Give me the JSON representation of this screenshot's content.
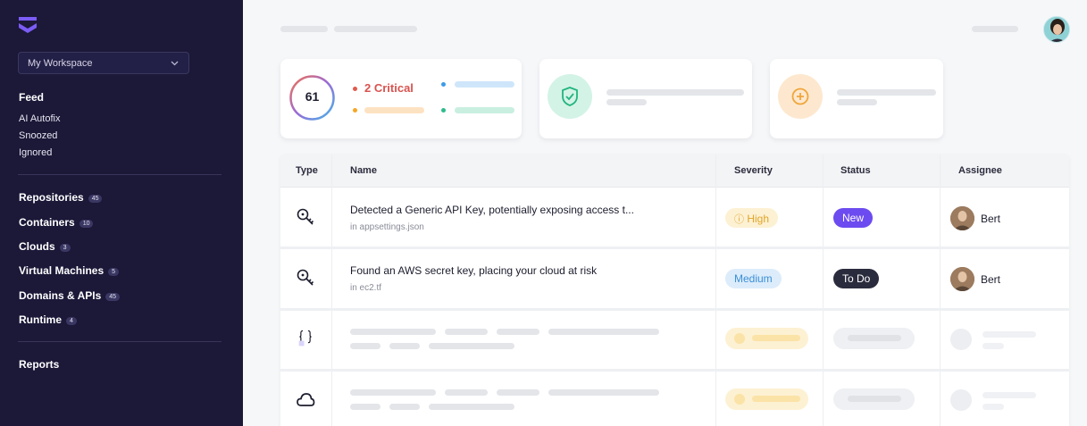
{
  "sidebar": {
    "workspace": "My Workspace",
    "feed_label": "Feed",
    "feed_items": [
      "AI Autofix",
      "Snoozed",
      "Ignored"
    ],
    "nav": [
      {
        "label": "Repositories",
        "count": "45"
      },
      {
        "label": "Containers",
        "count": "10"
      },
      {
        "label": "Clouds",
        "count": "3"
      },
      {
        "label": "Virtual Machines",
        "count": "5"
      },
      {
        "label": "Domains & APIs",
        "count": "45"
      },
      {
        "label": "Runtime",
        "count": "4"
      }
    ],
    "reports_label": "Reports"
  },
  "summary": {
    "score": "61",
    "critical_label": "2 Critical"
  },
  "table": {
    "headers": [
      "Type",
      "Name",
      "Severity",
      "Status",
      "Assignee"
    ],
    "rows": [
      {
        "type_icon": "key-search-icon",
        "title": "Detected a Generic API Key, potentially exposing access t...",
        "subtitle": "in appsettings.json",
        "severity": "High",
        "severity_icon": "info-circle-icon",
        "status": "New",
        "assignee": "Bert"
      },
      {
        "type_icon": "key-search-icon",
        "title": "Found an AWS secret key, placing your cloud at risk",
        "subtitle": "in ec2.tf",
        "severity": "Medium",
        "status": "To Do",
        "assignee": "Bert"
      },
      {
        "type_icon": "code-braces-icon"
      },
      {
        "type_icon": "cloud-icon"
      }
    ]
  },
  "colors": {
    "sidebar_bg": "#1b1838",
    "accent": "#6c5ce7",
    "critical": "#d9534f",
    "high_bg": "#fdf1d3",
    "medium_bg": "#dcecfb",
    "new_bg": "#6c4bf0",
    "todo_bg": "#2a2b3d"
  }
}
